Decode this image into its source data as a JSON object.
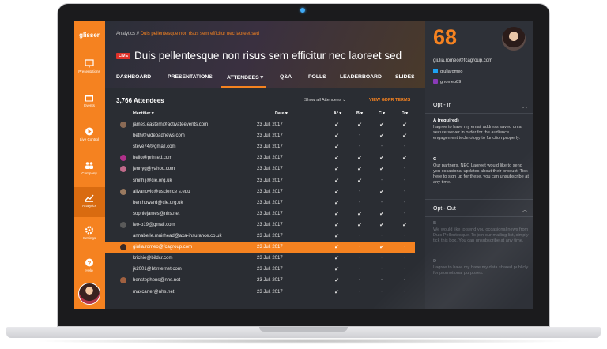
{
  "app": {
    "logo": "glisser"
  },
  "sidebar": {
    "items": [
      {
        "label": "Presentations",
        "icon": "presentation-icon"
      },
      {
        "label": "Events",
        "icon": "calendar-icon"
      },
      {
        "label": "Live Control",
        "icon": "play-icon"
      },
      {
        "label": "Company",
        "icon": "people-icon"
      },
      {
        "label": "Analytics",
        "icon": "chart-icon",
        "active": true
      },
      {
        "label": "Settings",
        "icon": "gear-icon"
      },
      {
        "label": "Help",
        "icon": "help-icon"
      }
    ]
  },
  "header": {
    "breadcrumb_root": "Analytics //",
    "breadcrumb_current": "Duis pellentesque non risus sem efficitur nec laoreet sed",
    "live_label": "LIVE",
    "title": "Duis pellentesque non risus sem efficitur nec laoreet sed"
  },
  "tabs": [
    {
      "label": "DASHBOARD"
    },
    {
      "label": "PRESENTATIONS"
    },
    {
      "label": "ATTENDEES ▾",
      "active": true
    },
    {
      "label": "Q&A"
    },
    {
      "label": "POLLS"
    },
    {
      "label": "LEADERBOARD"
    },
    {
      "label": "SLIDES"
    }
  ],
  "attendees": {
    "count_label": "3,766 Attendees",
    "filter_label": "Show all Attendees ⌄",
    "gdpr_label": "VIEW GDPR TERMS",
    "columns": {
      "identifier": "Identifier ▾",
      "date": "Date ▾",
      "a": "A* ▾",
      "b": "B ▾",
      "c": "C ▾",
      "d": "D ▾"
    },
    "rows": [
      {
        "email": "james.eastern@activateevents.com",
        "date": "23 Jul. 2017",
        "a": "✔",
        "b": "✔",
        "c": "✔",
        "d": "✔",
        "avatar": "#8a6a55"
      },
      {
        "email": "beth@videoadnews.com",
        "date": "23 Jul. 2017",
        "a": "✔",
        "b": "-",
        "c": "✔",
        "d": "✔",
        "avatar": ""
      },
      {
        "email": "steve74@gmail.com",
        "date": "23 Jul. 2017",
        "a": "✔",
        "b": "-",
        "c": "-",
        "d": "-",
        "avatar": ""
      },
      {
        "email": "hello@printed.com",
        "date": "23 Jul. 2017",
        "a": "✔",
        "b": "✔",
        "c": "✔",
        "d": "✔",
        "avatar": "#b0308a"
      },
      {
        "email": "jennyg@yahoo.com",
        "date": "23 Jul. 2017",
        "a": "✔",
        "b": "✔",
        "c": "✔",
        "d": "-",
        "avatar": "#c06a8a"
      },
      {
        "email": "smith.j@cie.org.uk",
        "date": "23 Jul. 2017",
        "a": "✔",
        "b": "✔",
        "c": "-",
        "d": "-",
        "avatar": ""
      },
      {
        "email": "aiivanovic@uscience s.edu",
        "date": "23 Jul. 2017",
        "a": "✔",
        "b": "-",
        "c": "✔",
        "d": "-",
        "avatar": "#9a7a60"
      },
      {
        "email": "ben.howard@cie.org.uk",
        "date": "23 Jul. 2017",
        "a": "✔",
        "b": "-",
        "c": "-",
        "d": "-",
        "avatar": ""
      },
      {
        "email": "sophiejames@nhs.net",
        "date": "23 Jul. 2017",
        "a": "✔",
        "b": "✔",
        "c": "✔",
        "d": "-",
        "avatar": ""
      },
      {
        "email": "leo-b19@gmail.com",
        "date": "23 Jul. 2017",
        "a": "✔",
        "b": "✔",
        "c": "✔",
        "d": "✔",
        "avatar": "#5a5a5a"
      },
      {
        "email": "annabelle.muirhead@axa-insurance.co.uk",
        "date": "23 Jul. 2017",
        "a": "✔",
        "b": "-",
        "c": "-",
        "d": "-",
        "avatar": ""
      },
      {
        "email": "giulia.romeo@fcagroup.com",
        "date": "23 Jul. 2017",
        "a": "✔",
        "b": "-",
        "c": "✔",
        "d": "-",
        "avatar": "#3a2a26",
        "highlight": true
      },
      {
        "email": "krichie@bildcr.com",
        "date": "23 Jul. 2017",
        "a": "✔",
        "b": "-",
        "c": "-",
        "d": "-",
        "avatar": ""
      },
      {
        "email": "jk2001@btinternet.com",
        "date": "23 Jul. 2017",
        "a": "✔",
        "b": "-",
        "c": "-",
        "d": "-",
        "avatar": ""
      },
      {
        "email": "benstephens@nhs.net",
        "date": "23 Jul. 2017",
        "a": "✔",
        "b": "-",
        "c": "-",
        "d": "-",
        "avatar": "#a06040"
      },
      {
        "email": "maxcarter@nhs.net",
        "date": "23 Jul. 2017",
        "a": "✔",
        "b": "-",
        "c": "-",
        "d": "-",
        "avatar": ""
      }
    ]
  },
  "profile": {
    "score": "68",
    "email": "giulia.romeo@fcagroup.com",
    "twitter": "giuliaromeo",
    "instagram": "g.romeo89"
  },
  "optin": {
    "title": "Opt - In",
    "a_heading": "A (required)",
    "a_text": "I agree to have my email address saved on a secure server in order for the audience engagement technology to function properly.",
    "c_heading": "C",
    "c_text": "Our partners, NEC Laoreet would like to send you occasional updates about their product. Tick here to sign up for these, you can unsubscribe at any time."
  },
  "optout": {
    "title": "Opt - Out",
    "b_heading": "B",
    "b_text": "We would like to send you occasional news from Duis Pellentesque. To join our mailing list, simply tick this box. You can unsubscribe at any time.",
    "d_heading": "D",
    "d_text": "I agree to have my have my data shared publicly for promotional purposes."
  },
  "colors": {
    "accent": "#f58220",
    "live": "#e0322a",
    "twitter": "#1da1f2",
    "instagram": "#8a3ab9"
  }
}
